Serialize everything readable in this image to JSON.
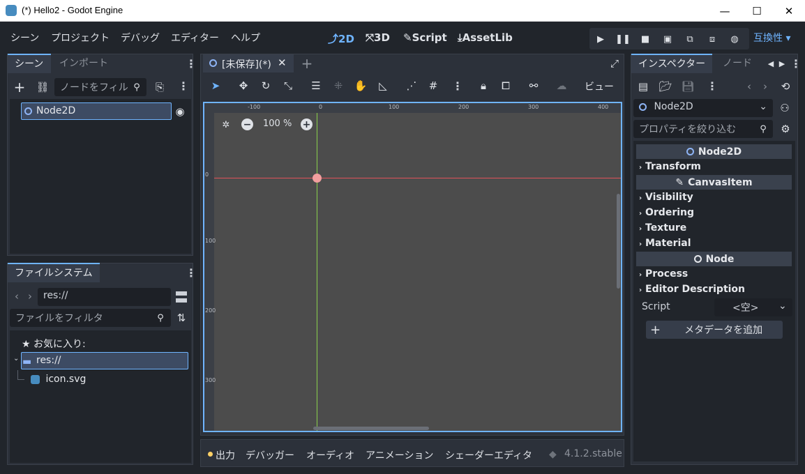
{
  "window": {
    "title": "(*) Hello2 - Godot Engine",
    "min_glyph": "—",
    "max_glyph": "☐",
    "close_glyph": "✕"
  },
  "menu": {
    "items": [
      "シーン",
      "プロジェクト",
      "デバッグ",
      "エディター",
      "ヘルプ"
    ]
  },
  "workspaces": [
    {
      "label": "2D",
      "active": true,
      "icon": "2d-icon"
    },
    {
      "label": "3D",
      "active": false,
      "icon": "3d-icon"
    },
    {
      "label": "Script",
      "active": false,
      "icon": "script-icon"
    },
    {
      "label": "AssetLib",
      "active": false,
      "icon": "assetlib-icon"
    }
  ],
  "renderer": {
    "label": "互換性",
    "caret": "▾"
  },
  "scene_dock": {
    "tab_active": "シーン",
    "tab_inactive": "インポート",
    "filter_placeholder": "ノードをフィル",
    "root_node": "Node2D"
  },
  "filesystem_dock": {
    "tab": "ファイルシステム",
    "path": "res://",
    "filter_placeholder": "ファイルをフィルタ",
    "favorites": "お気に入り:",
    "folder": "res://",
    "file": "icon.svg"
  },
  "editor": {
    "scene_tab": "[未保存](*)",
    "view_menu": "ビュー",
    "zoom": "100 %"
  },
  "rulers": {
    "top": [
      "-100",
      "0",
      "100",
      "200",
      "300",
      "400"
    ],
    "left": [
      "0",
      "100",
      "200",
      "300"
    ]
  },
  "bottom_panel": {
    "tabs": [
      "出力",
      "デバッガー",
      "オーディオ",
      "アニメーション",
      "シェーダーエディタ"
    ],
    "version": "4.1.2.stable"
  },
  "inspector": {
    "tab_active": "インスペクター",
    "tab_inactive": "ノード",
    "node_select": "Node2D",
    "filter_placeholder": "プロパティを絞り込む",
    "section_node2d": "Node2D",
    "section_canvasitem": "CanvasItem",
    "section_node": "Node",
    "props": [
      "Transform",
      "Visibility",
      "Ordering",
      "Texture",
      "Material",
      "Process",
      "Editor Description"
    ],
    "script_label": "Script",
    "script_value": "<空>",
    "add_metadata": "メタデータを追加"
  },
  "colors": {
    "accent": "#6fb4ff",
    "background": "#21252b",
    "panel": "#2c313a",
    "viewport": "#4c4c4c",
    "x_axis": "#e0525a",
    "y_axis": "#8ad04c"
  }
}
